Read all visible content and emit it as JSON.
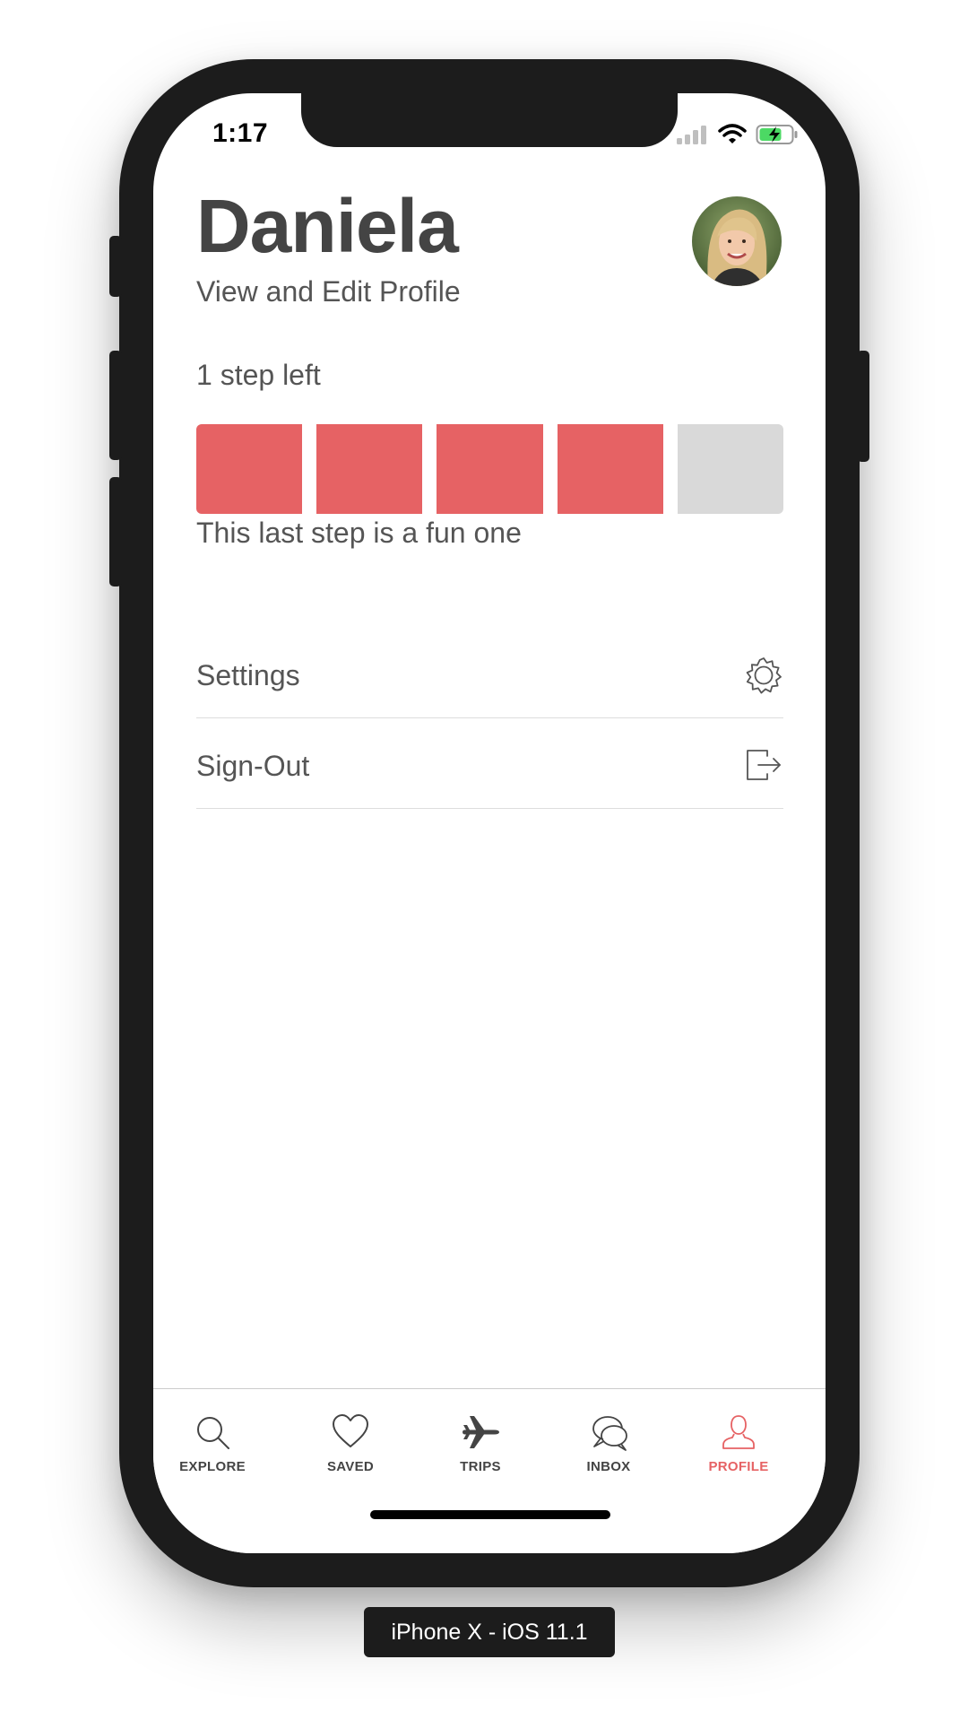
{
  "status_bar": {
    "time": "1:17",
    "icons": [
      "cellular-signal-icon",
      "wifi-icon",
      "battery-charging-icon"
    ]
  },
  "profile": {
    "name": "Daniela",
    "edit_link": "View and Edit Profile",
    "avatar": "user-avatar-photo"
  },
  "progress": {
    "steps_left_label": "1 step left",
    "total_steps": 5,
    "completed_steps": 4,
    "caption": "This last step is a fun one"
  },
  "menu": [
    {
      "label": "Settings",
      "icon": "gear-icon"
    },
    {
      "label": "Sign-Out",
      "icon": "sign-out-icon"
    }
  ],
  "tabbar": {
    "tabs": [
      {
        "label": "EXPLORE",
        "icon": "search-icon",
        "active": false
      },
      {
        "label": "SAVED",
        "icon": "heart-icon",
        "active": false
      },
      {
        "label": "TRIPS",
        "icon": "airplane-icon",
        "active": false
      },
      {
        "label": "INBOX",
        "icon": "chat-bubbles-icon",
        "active": false
      },
      {
        "label": "PROFILE",
        "icon": "person-icon",
        "active": true
      }
    ]
  },
  "device_label": "iPhone X - iOS 11.1",
  "colors": {
    "accent": "#E66264",
    "step_done": "#E66264",
    "step_pending": "#D9D9D9",
    "text_primary": "#444444",
    "text_secondary": "#555555",
    "device_frame": "#1C1C1C"
  }
}
